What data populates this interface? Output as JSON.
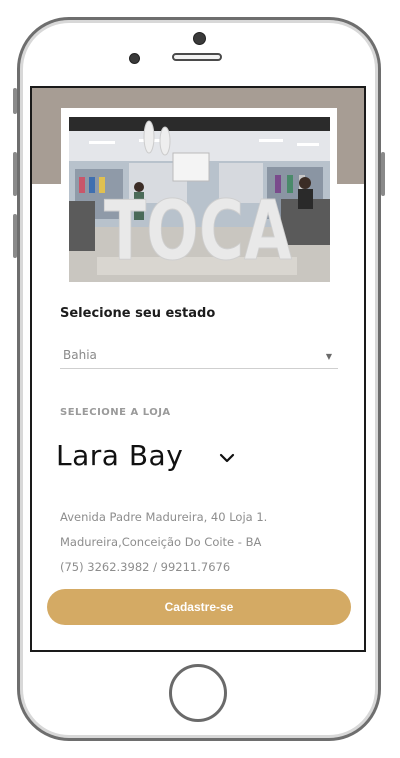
{
  "photo": {
    "sign_text": "TOCA"
  },
  "state": {
    "label": "Selecione seu estado",
    "selected": "Bahia"
  },
  "store": {
    "label": "SELECIONE A LOJA",
    "name": "Lara Bay"
  },
  "address": {
    "line1": "Avenida Padre Madureira, 40 Loja 1.",
    "line2": "Madureira,Conceição Do Coite - BA",
    "phones": "(75) 3262.3982 / 99211.7676"
  },
  "cta": {
    "label": "Cadastre-se"
  },
  "colors": {
    "banner": "#a79d94",
    "button": "#d4aa64"
  }
}
